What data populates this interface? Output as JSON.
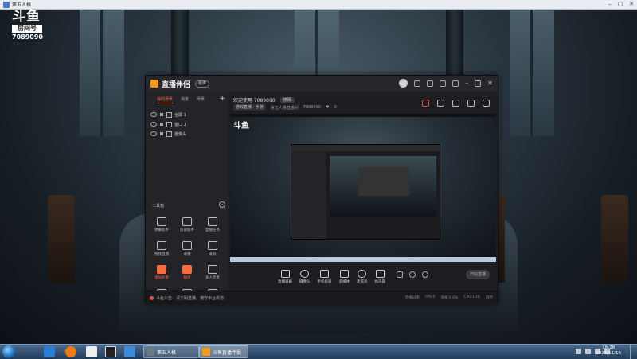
{
  "game": {
    "window_title": "第五人格",
    "logo_brand": "斗鱼",
    "room_label": "房间号",
    "room_id": "7089090"
  },
  "app": {
    "name": "直播伴侣",
    "version_badge": "标准",
    "scene_tabs": [
      "我的场景",
      "场景",
      "场景"
    ],
    "sources": [
      {
        "label": "全屏 1"
      },
      {
        "label": "窗口 1"
      },
      {
        "label": "摄像头"
      }
    ],
    "toolbox_title": "工具箱",
    "tools": [
      {
        "label": "弹幕助手",
        "hot": false
      },
      {
        "label": "房管助手",
        "hot": false
      },
      {
        "label": "直播任务",
        "hot": false
      },
      {
        "label": "视频直播",
        "hot": false
      },
      {
        "label": "录播",
        "hot": false
      },
      {
        "label": "录屏",
        "hot": false
      },
      {
        "label": "虚拟形象",
        "hot": true
      },
      {
        "label": "抽奖",
        "hot": true
      },
      {
        "label": "多人连麦",
        "hot": false
      },
      {
        "label": "屏幕共享",
        "hot": false
      },
      {
        "label": "互动",
        "hot": false
      },
      {
        "label": "更多",
        "hot": false
      }
    ],
    "welcome_text": "欢迎使用 7089090",
    "welcome_button": "修改",
    "category": "游戏直播 · 手游",
    "room_title": "第五人格直播间",
    "room_number_small": "7089090",
    "fans": "0",
    "preview_logo": "斗鱼",
    "controls": [
      {
        "label": "直播屏幕"
      },
      {
        "label": "摄像头"
      },
      {
        "label": "手机投屏"
      },
      {
        "label": "多媒体"
      },
      {
        "label": "麦克风"
      },
      {
        "label": "扬声器"
      }
    ],
    "start_button": "开始直播",
    "status_message": "斗鱼公告：请文明直播，遵守平台规范",
    "stats": [
      "直播码率",
      "FPS:0",
      "丢帧:0.0%",
      "CPU:10%",
      "内存"
    ]
  },
  "taskbar": {
    "task1_label": "第五人格",
    "task2_label": "斗鱼直播伴侣",
    "time": "16:28",
    "date": "2021/11/16"
  }
}
